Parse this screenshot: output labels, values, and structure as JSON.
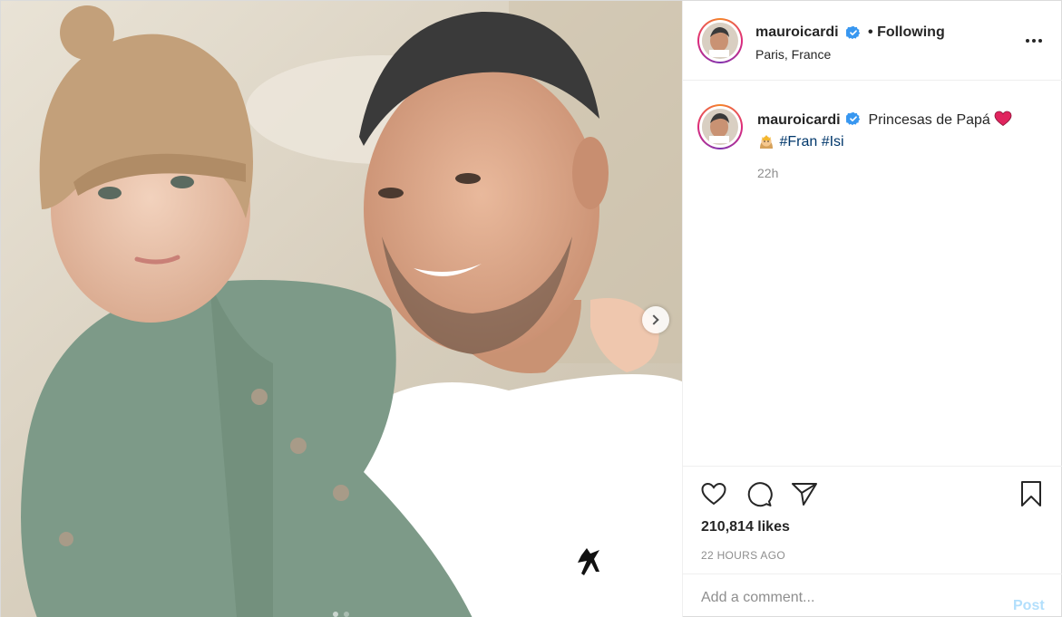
{
  "post": {
    "photo_alt": "",
    "carousel_next_icon": "chevron-right-icon",
    "carousel_dots": 2
  },
  "header": {
    "username": "mauroicardi",
    "verified_icon": "verified-badge-icon",
    "separator": "•",
    "follow_status": "Following",
    "location": "Paris, France",
    "more_icon": "more-horizontal-icon"
  },
  "caption": {
    "username": "mauroicardi",
    "text": "Princesas de Papá",
    "heart_emoji": "red-heart-emoji",
    "princess_emoji": "princess-emoji",
    "hashtags": [
      "#Fran",
      "#Isi"
    ],
    "time": "22h"
  },
  "actions": {
    "like_icon": "heart-icon",
    "comment_icon": "comment-icon",
    "share_icon": "paper-plane-icon",
    "save_icon": "bookmark-icon",
    "likes_text": "210,814 likes",
    "time_ago": "22 HOURS AGO"
  },
  "comment": {
    "placeholder": "Add a comment...",
    "post_label": "Post"
  },
  "colors": {
    "text": "#262626",
    "muted": "#8e8e8e",
    "verified": "#3897f0",
    "hashtag": "#00376b",
    "post_disabled": "#b2dffc",
    "border": "#dbdbdb"
  }
}
